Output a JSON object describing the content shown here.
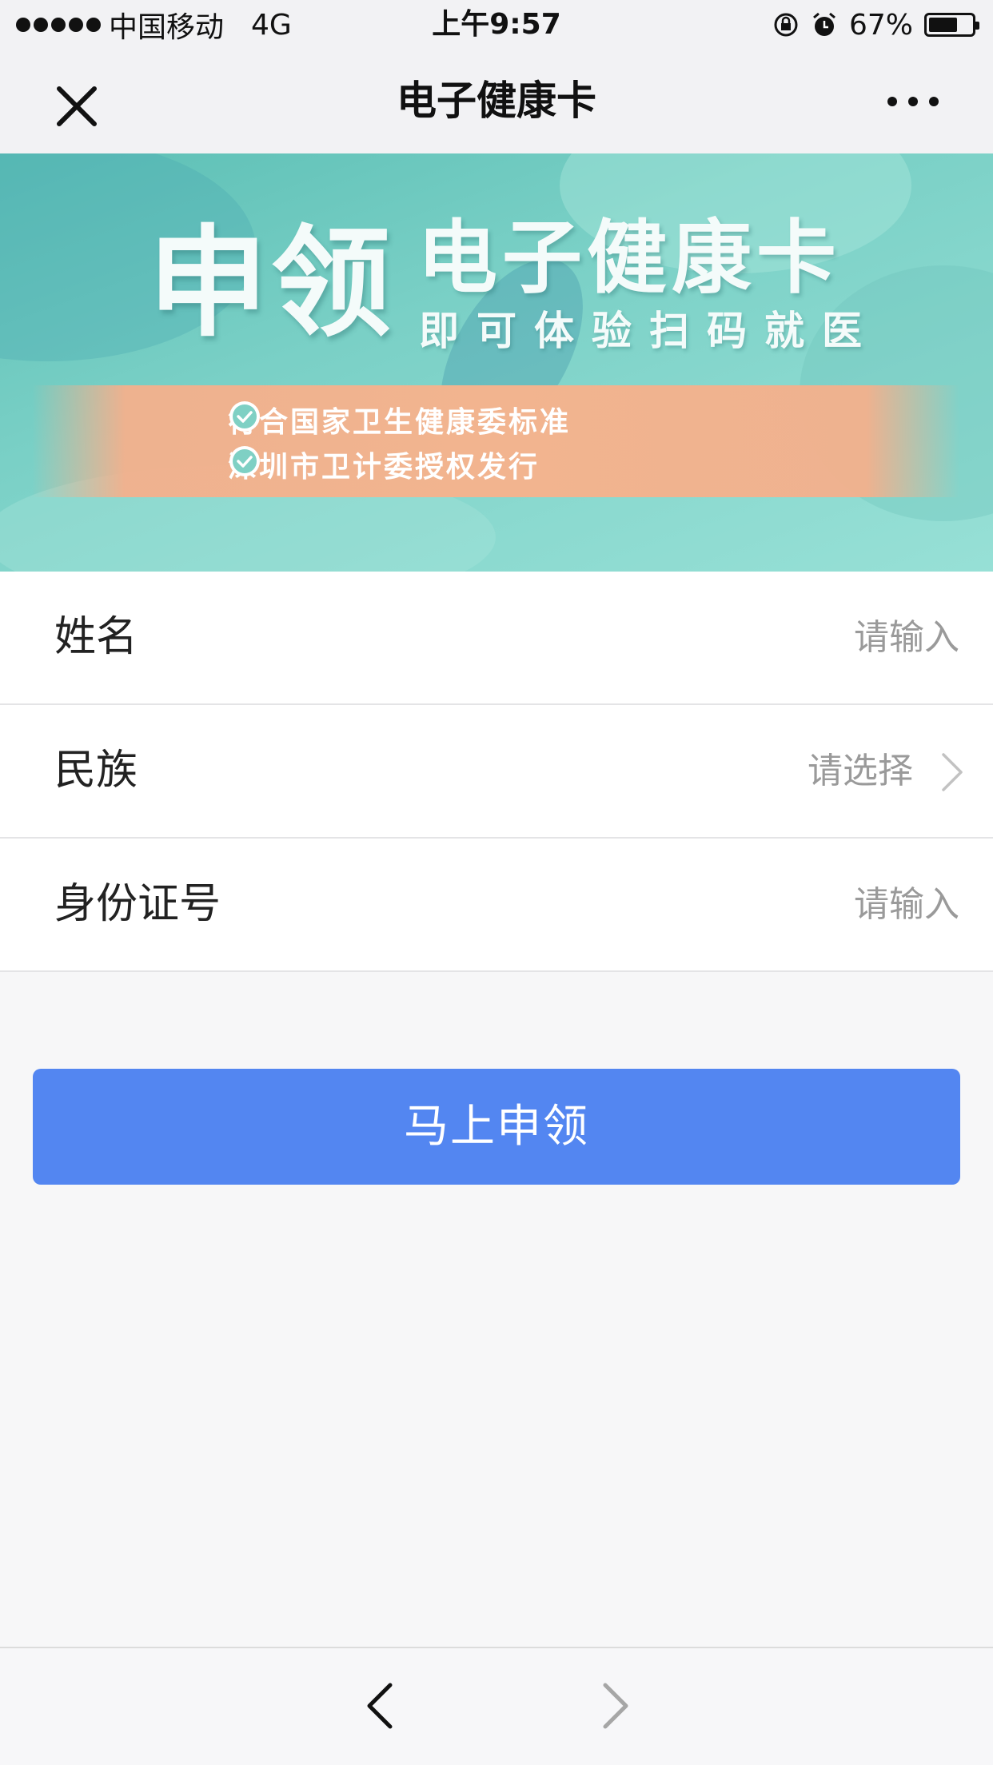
{
  "status_bar": {
    "carrier": "中国移动",
    "network": "4G",
    "time": "上午9:57",
    "battery_percent": "67%",
    "battery_level": 0.67
  },
  "nav": {
    "title": "电子健康卡",
    "close_icon": "close-icon",
    "more_icon": "more-icon"
  },
  "banner": {
    "big_text": "申领",
    "title": "电子健康卡",
    "subtitle": "即可体验扫码就医",
    "badges": [
      "符合国家卫生健康委标准",
      "深圳市卫计委授权发行"
    ]
  },
  "form": {
    "rows": [
      {
        "label": "姓名",
        "placeholder": "请输入"
      },
      {
        "label": "民族",
        "placeholder": "请选择"
      },
      {
        "label": "身份证号",
        "placeholder": "请输入"
      }
    ]
  },
  "actions": {
    "submit_label": "马上申领"
  },
  "colors": {
    "accent": "#5386f1",
    "banner": "#7ad0c6",
    "ribbon": "#f2b48f"
  }
}
